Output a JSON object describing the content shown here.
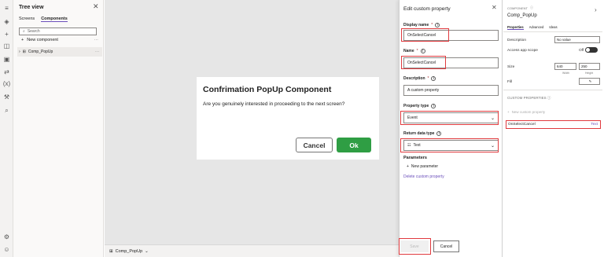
{
  "rail": {
    "icons": [
      "menu-icon",
      "layers-icon",
      "plus-icon",
      "database-icon",
      "media-icon",
      "flow-icon",
      "variables-icon",
      "tools-icon",
      "search-icon",
      "settings-icon",
      "account-icon"
    ]
  },
  "tree": {
    "title": "Tree view",
    "tabs": [
      "Screens",
      "Components"
    ],
    "active_tab": "Components",
    "search_placeholder": "Search",
    "new_component": "New component",
    "component_name": "Comp_PopUp",
    "more": "···"
  },
  "canvas": {
    "popup": {
      "title": "Confrimation PopUp Component",
      "message": "Are you genuinely interested in proceeding to the next screen?",
      "cancel_label": "Cancel",
      "ok_label": "Ok",
      "ok_color": "#2f9e44"
    },
    "footer_component": "Comp_PopUp"
  },
  "edit_panel": {
    "title": "Edit custom property",
    "display_name": {
      "label": "Display name",
      "value": "OnSelectCancel"
    },
    "name": {
      "label": "Name",
      "value": "OnSelectCancel"
    },
    "description": {
      "label": "Description",
      "value": "A custom property"
    },
    "property_type": {
      "label": "Property type",
      "value": "Event"
    },
    "return_type": {
      "label": "Return data type",
      "value": "Text"
    },
    "parameters_title": "Parameters",
    "new_parameter": "New parameter",
    "delete_link": "Delete custom property",
    "save_label": "Save",
    "cancel_label": "Cancel",
    "highlight_color": "#e03a3e"
  },
  "props_panel": {
    "caption": "COMPONENT",
    "name": "Comp_PopUp",
    "tabs": [
      "Properties",
      "Advanced",
      "Ideas"
    ],
    "active_tab": "Properties",
    "description_label": "Description",
    "description_value": "No value",
    "access_label": "Access app scope",
    "access_value": "Off",
    "size_label": "Size",
    "width": "640",
    "height": "250",
    "width_label": "Width",
    "height_label": "Height",
    "fill_label": "Fill",
    "custom_props_header": "CUSTOM PROPERTIES",
    "new_custom": "New custom property",
    "custom_item_name": "OnSelectCancel",
    "custom_item_type": "Text"
  }
}
